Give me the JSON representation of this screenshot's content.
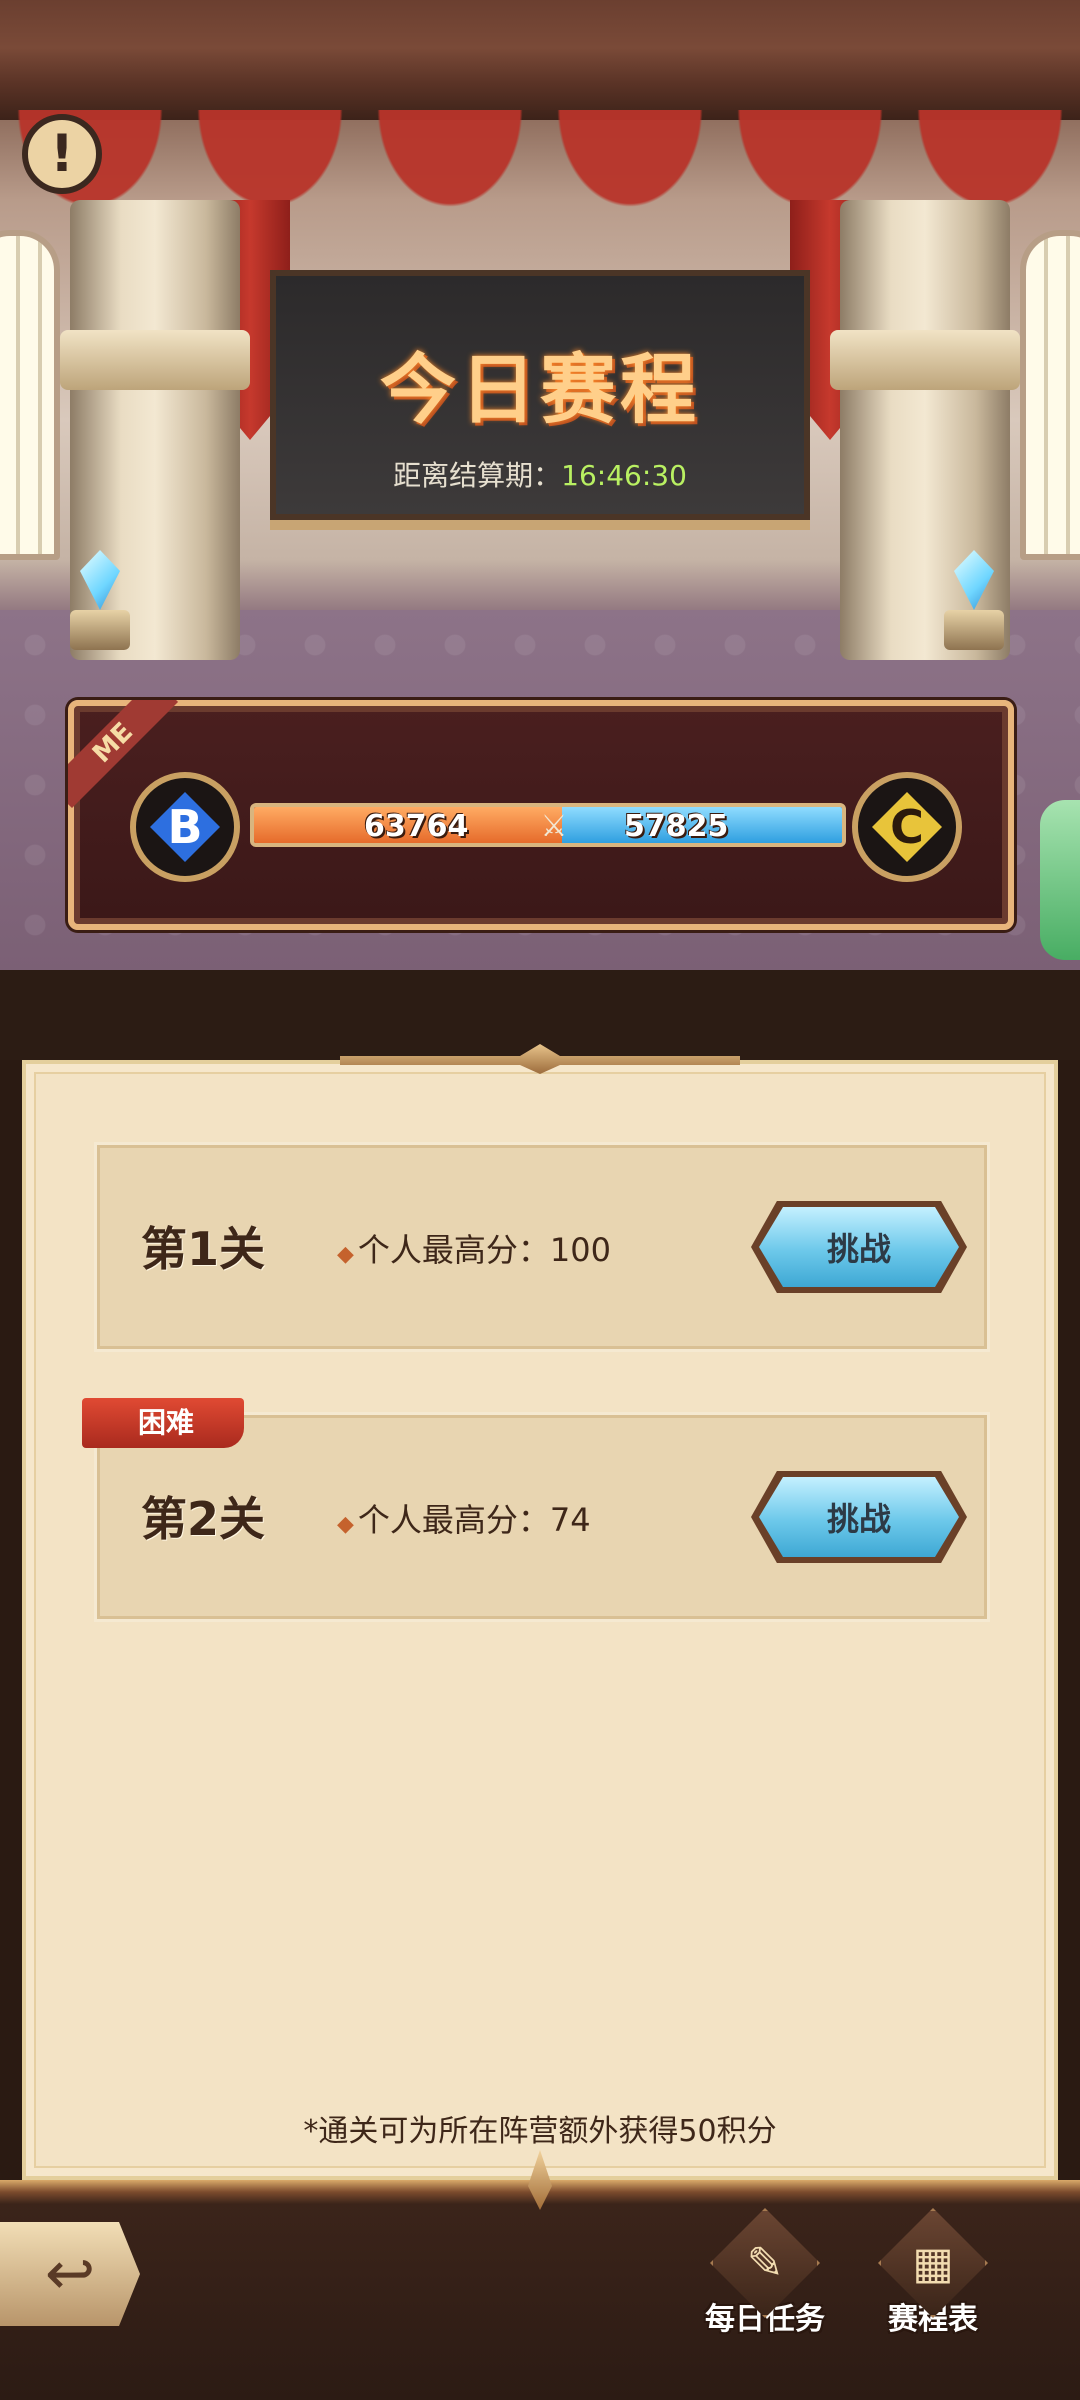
{
  "header": {
    "title": "今日赛程",
    "countdown_label": "距离结算期：",
    "countdown_value": "16:46:30"
  },
  "icons": {
    "alert": "!",
    "swords": "⚔",
    "back": "↩",
    "daily_tasks": "✎",
    "schedule": "▦"
  },
  "score_panel": {
    "me_tag": "ME",
    "left_team": {
      "letter": "B",
      "score": "63764",
      "color": "#2d6fe0"
    },
    "right_team": {
      "letter": "C",
      "score": "57825",
      "color": "#e8c43a"
    },
    "left_ratio": 0.5244
  },
  "stages": [
    {
      "name": "第1关",
      "score_label": "个人最高分：100",
      "button": "挑战",
      "tag": ""
    },
    {
      "name": "第2关",
      "score_label": "个人最高分：74",
      "button": "挑战",
      "tag": "困难"
    }
  ],
  "footnote": "*通关可为所在阵营额外获得50积分",
  "bottom_nav": [
    {
      "label": "每日任务"
    },
    {
      "label": "赛程表"
    }
  ]
}
